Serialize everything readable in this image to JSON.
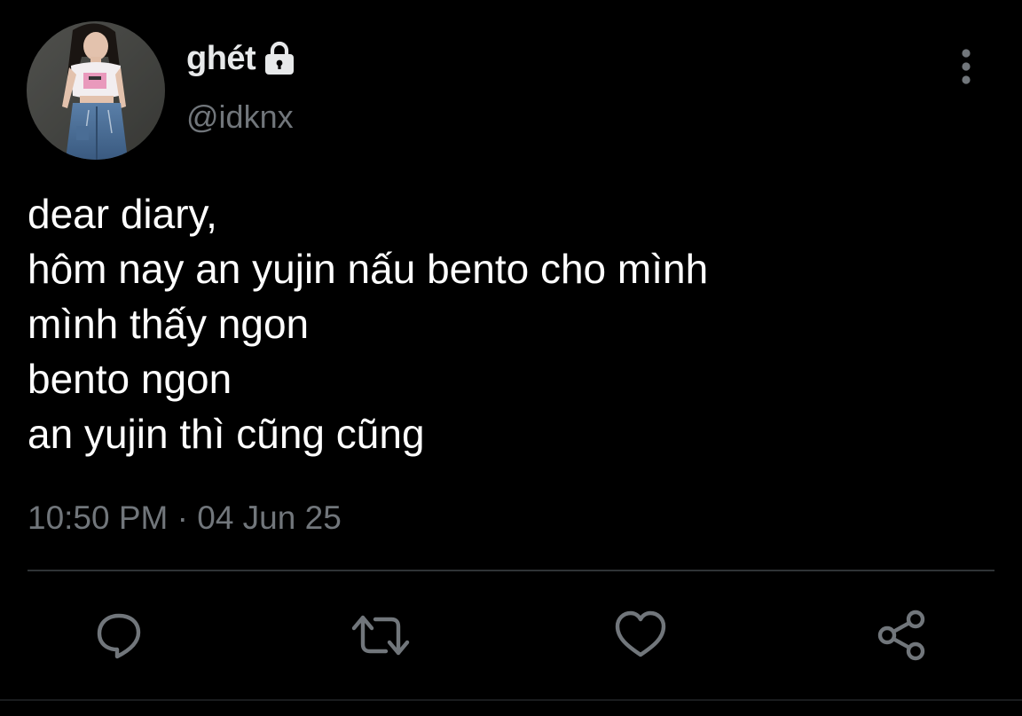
{
  "user": {
    "display_name": "ghét",
    "handle": "@idknx",
    "avatar_icon": "profile-photo",
    "protected_icon": "lock-icon"
  },
  "tweet": {
    "lines": [
      "dear diary,",
      "hôm nay an yujin nấu bento cho mình",
      "mình thấy ngon",
      "bento ngon",
      "an yujin thì cũng cũng"
    ],
    "timestamp": "10:50 PM · 04 Jun 25"
  },
  "actions": [
    {
      "name": "reply",
      "icon": "speech-bubble-icon"
    },
    {
      "name": "retweet",
      "icon": "retweet-arrows-icon"
    },
    {
      "name": "like",
      "icon": "heart-icon"
    },
    {
      "name": "share",
      "icon": "share-nodes-icon"
    }
  ],
  "colors": {
    "background": "#000000",
    "primary_text": "#e7e9ea",
    "secondary_text": "#71767b",
    "divider": "#2f3336"
  }
}
